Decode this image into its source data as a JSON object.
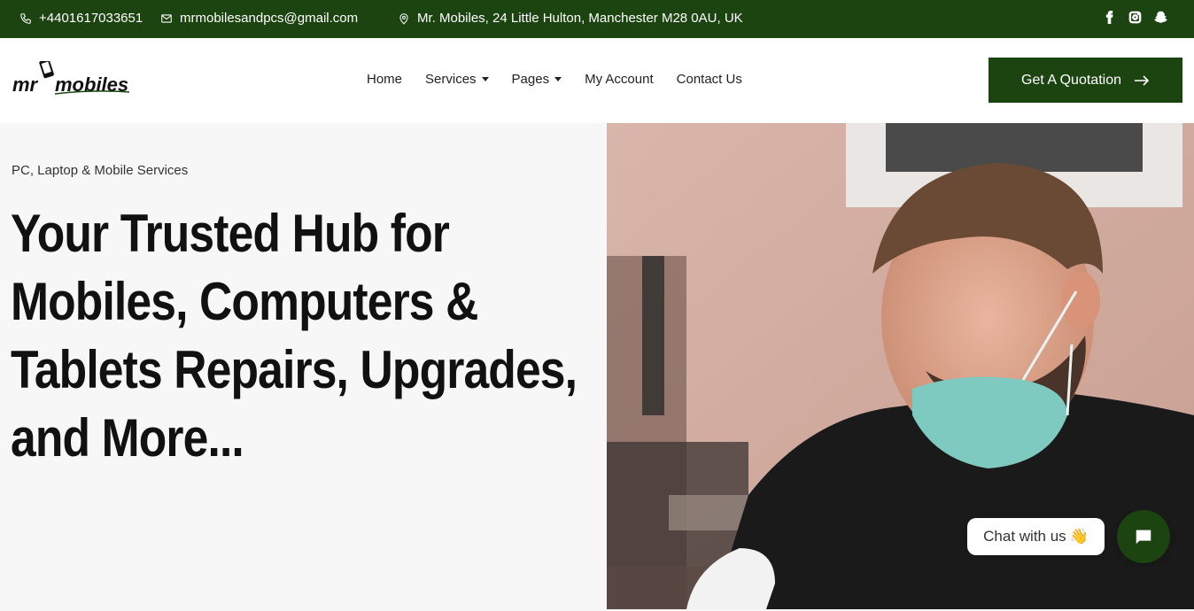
{
  "topbar": {
    "phone": "+4401617033651",
    "email": "mrmobilesandpcs@gmail.com",
    "address": "Mr. Mobiles, 24 Little Hulton, Manchester M28 0AU, UK",
    "icons": [
      "phone-icon",
      "mail-icon",
      "location-pin-icon",
      "facebook-icon",
      "instagram-icon",
      "snapchat-icon"
    ]
  },
  "header": {
    "logo_text": "mr mobiles",
    "nav": [
      {
        "label": "Home"
      },
      {
        "label": "Services"
      },
      {
        "label": "Pages"
      },
      {
        "label": "My Account"
      },
      {
        "label": "Contact Us"
      }
    ],
    "cta": "Get A Quotation"
  },
  "hero": {
    "eyebrow": "PC, Laptop & Mobile Services",
    "headline_lines": [
      "Your Trusted Hub for",
      "Mobiles, Computers &",
      "Tablets Repairs, Upgrades,",
      "and More..."
    ]
  },
  "chat": {
    "label": "Chat with us",
    "emoji": "👋"
  },
  "colors": {
    "brand_green": "#1c4410",
    "background": "#f7f7f7"
  }
}
